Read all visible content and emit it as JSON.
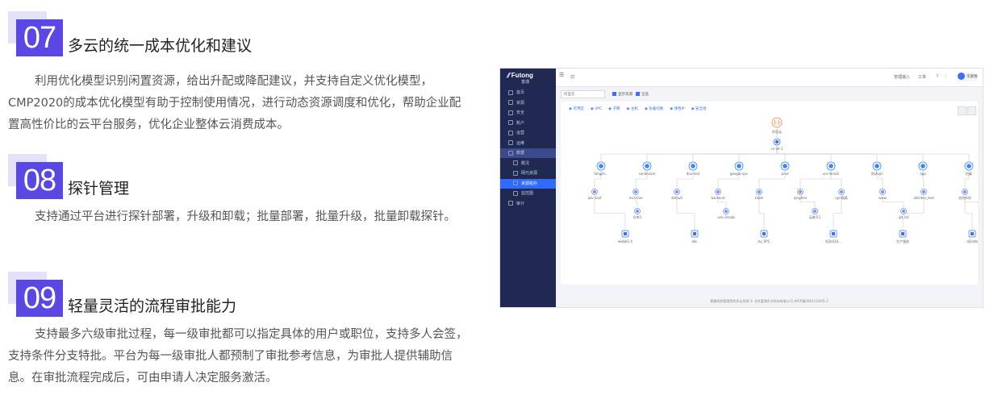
{
  "features": [
    {
      "number": "07",
      "title": "多云的统一成本优化和建议",
      "description": "利用优化模型识别闲置资源，给出升配或降配建议，并支持自定义优化模型，CMP2020的成本优化模型有助于控制使用情况，进行动态资源调度和优化，帮助企业配置高性价比的云平台服务，优化企业整体云消费成本。"
    },
    {
      "number": "08",
      "title": "探针管理",
      "description": "支持通过平台进行探针部署，升级和卸载；批量部署，批量升级，批量卸载探针。"
    },
    {
      "number": "09",
      "title": "轻量灵活的流程审批能力",
      "description": "支持最多六级审批过程，每一级审批都可以指定具体的用户或职位，支持多人会签，支持条件分支特批。平台为每一级审批人都预制了审批参考信息，为审批人提供辅助信息。在审批流程完成后，可由申请人决定服务激活。"
    }
  ],
  "screenshot": {
    "logo": "Futong",
    "logo_sub": "富通",
    "header_left": "切",
    "header_right": [
      "管理输入",
      "工单",
      "?",
      "⋮"
    ],
    "avatar_label": "华富锦",
    "sidebar": [
      {
        "label": "首页"
      },
      {
        "label": "资源"
      },
      {
        "label": "安全"
      },
      {
        "label": "账户"
      },
      {
        "label": "运营"
      },
      {
        "label": "运维"
      },
      {
        "label": "数据",
        "state": "active"
      },
      {
        "label": "概况",
        "sub": true
      },
      {
        "label": "网元资源",
        "sub": true
      },
      {
        "label": "资源拓扑",
        "sub": true,
        "state": "selected"
      },
      {
        "label": "监控图",
        "sub": true
      },
      {
        "label": "审计"
      }
    ],
    "select_value": "阿里云",
    "controls": [
      "显示资源",
      "全选"
    ],
    "tabs": [
      "可用区",
      "VPC",
      "子网",
      "主机",
      "负载均衡",
      "弹性IP",
      "安全组"
    ],
    "topology": {
      "root": "阿里云",
      "region": "cn-sh-1",
      "vpcs": [
        "fangzh...",
        "sandexam",
        "dev-test",
        "google-vpc",
        "prod",
        "uni-mindn",
        "测试vpc",
        "app",
        "仿真"
      ],
      "subnets": [
        "azv-1oof",
        "mcs-0xe",
        "default",
        "backend",
        "table",
        "qingfeel",
        "vpn隔离",
        "www",
        "allvideo_test",
        "合作伙伴"
      ],
      "instances_a": [
        "仓库1",
        "uno-2xaab",
        "云账号1",
        "ipt_h4",
        "后台服务"
      ],
      "instances_b": [
        "wwbb1-h",
        "abc",
        "by_RPC",
        "dJ3a01b...",
        "生产服务",
        "dJ3a4b"
      ]
    },
    "footer": "便捷高效管理您的多云资源 © 北京富通东方科技有限公司 京ICP备09011144号-2"
  }
}
